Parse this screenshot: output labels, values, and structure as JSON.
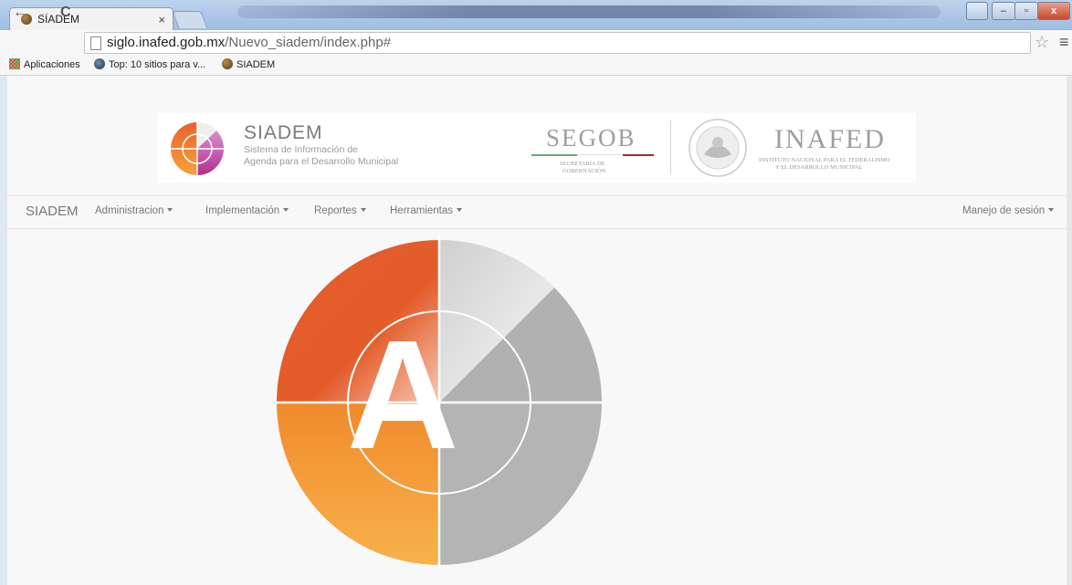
{
  "browser": {
    "tab_title": "SIADEM",
    "tab_close": "×",
    "url_host": "siglo.inafed.gob.mx",
    "url_path": "/Nuevo_siadem/index.php#",
    "window_controls": {
      "minimize": "–",
      "maximize": "▫",
      "close": "x"
    }
  },
  "bookmarks": [
    {
      "label": "Aplicaciones",
      "icon": "apps-grid-icon"
    },
    {
      "label": "Top: 10 sitios para v...",
      "icon": "globe-person-icon"
    },
    {
      "label": "SIADEM",
      "icon": "seal-icon"
    }
  ],
  "banner": {
    "siadem_title": "SIADEM",
    "siadem_subtitle_1": "Sistema de Información de",
    "siadem_subtitle_2": "Agenda para el Desarrollo Municipal",
    "segob_title": "SEGOB",
    "segob_sub_1": "SECRETARÍA DE",
    "segob_sub_2": "GOBERNACIÓN",
    "inafed_title": "INAFED",
    "inafed_sub_1": "INSTITUTO NACIONAL PARA EL FEDERALISMO",
    "inafed_sub_2": "Y EL DESARROLLO MUNICIPAL"
  },
  "navbar": {
    "brand": "SIADEM",
    "items": [
      "Administracion",
      "Implementación",
      "Reportes",
      "Herramientas"
    ],
    "session": "Manejo de sesión"
  },
  "hero": {
    "letter": "A"
  },
  "colors": {
    "orange": "#f0902e",
    "magenta": "#b8369a",
    "gray": "#b3b3b3",
    "segob_red": "#a6253b"
  }
}
